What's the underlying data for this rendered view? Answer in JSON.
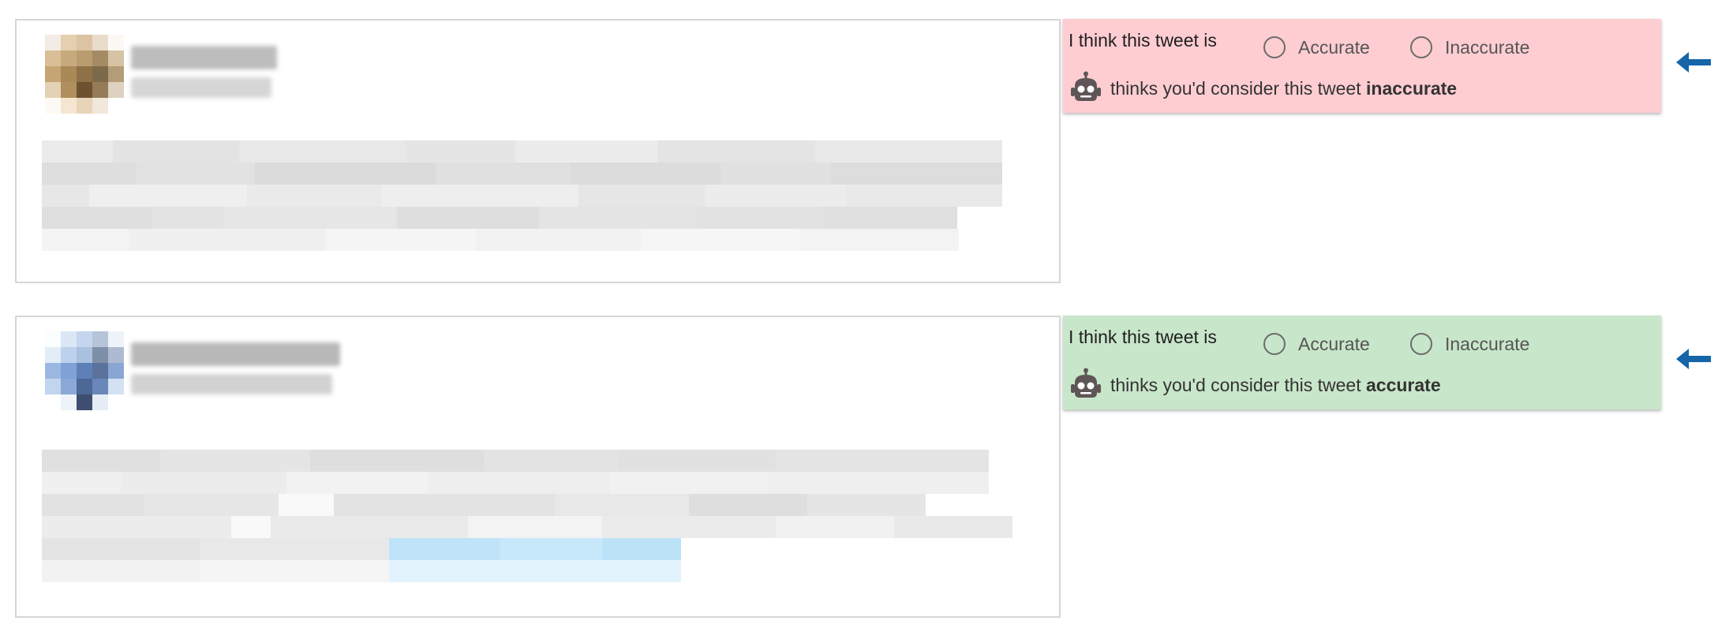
{
  "annotations": [
    {
      "prompt": "I think this tweet is",
      "options": [
        "Accurate",
        "Inaccurate"
      ],
      "ai_prefix": "thinks you'd consider this tweet",
      "ai_verdict": "inaccurate",
      "panel_color": "#fecdd1"
    },
    {
      "prompt": "I think this tweet is",
      "options": [
        "Accurate",
        "Inaccurate"
      ],
      "ai_prefix": "thinks you'd consider this tweet",
      "ai_verdict": "accurate",
      "panel_color": "#c8e6c9"
    }
  ],
  "colors": {
    "arrow": "#1565a8",
    "robot": "#5f5556",
    "card_border": "#d6d6d6"
  },
  "icons": {
    "robot": "robot-icon",
    "arrow": "left-arrow-icon",
    "radio": "radio-unchecked-icon"
  }
}
